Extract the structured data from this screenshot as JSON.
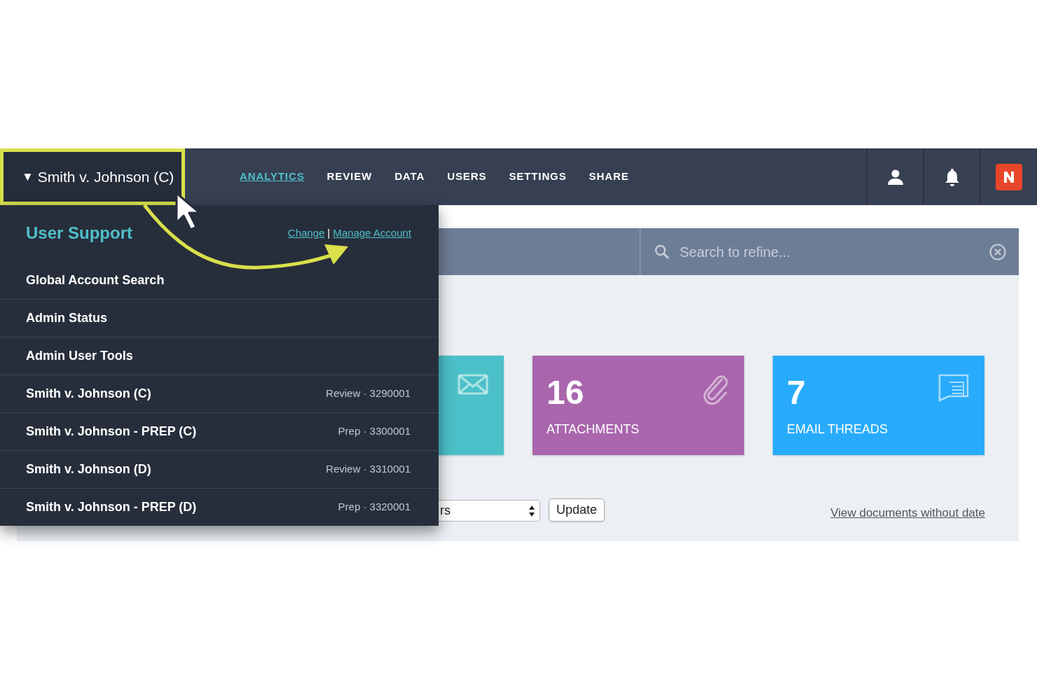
{
  "account_selector": {
    "caret": "▼",
    "label": "Smith v. Johnson (C)",
    "highlighted": true
  },
  "nav": [
    {
      "label": "ANALYTICS",
      "selected": true
    },
    {
      "label": "REVIEW",
      "selected": false
    },
    {
      "label": "DATA",
      "selected": false
    },
    {
      "label": "USERS",
      "selected": false
    },
    {
      "label": "SETTINGS",
      "selected": false
    },
    {
      "label": "SHARE",
      "selected": false
    }
  ],
  "dropdown": {
    "title": "User Support",
    "links": [
      "Change",
      "Manage Account"
    ],
    "separator": "|",
    "items": [
      {
        "label": "Global Account Search"
      },
      {
        "label": "Admin Status"
      },
      {
        "label": "Admin User Tools"
      },
      {
        "label": "Smith v. Johnson (C)",
        "meta": "Review · 3290001"
      },
      {
        "label": "Smith v. Johnson - PREP (C)",
        "meta": "Prep · 3300001"
      },
      {
        "label": "Smith v. Johnson (D)",
        "meta": "Review · 3310001"
      },
      {
        "label": "Smith v. Johnson - PREP (D)",
        "meta": "Prep · 3320001"
      }
    ]
  },
  "search": {
    "placeholder": "Search to refine..."
  },
  "cards": [
    {
      "kind": "mail",
      "color": "#4bc0c8"
    },
    {
      "kind": "attachment",
      "color": "#a966ad",
      "value": "16",
      "label": "ATTACHMENTS"
    },
    {
      "kind": "chat",
      "color": "#29abfb",
      "value": "7",
      "label": "EMAIL THREADS"
    }
  ],
  "controls": {
    "select_value": "rs",
    "button": "Update"
  },
  "link": "View documents without date"
}
